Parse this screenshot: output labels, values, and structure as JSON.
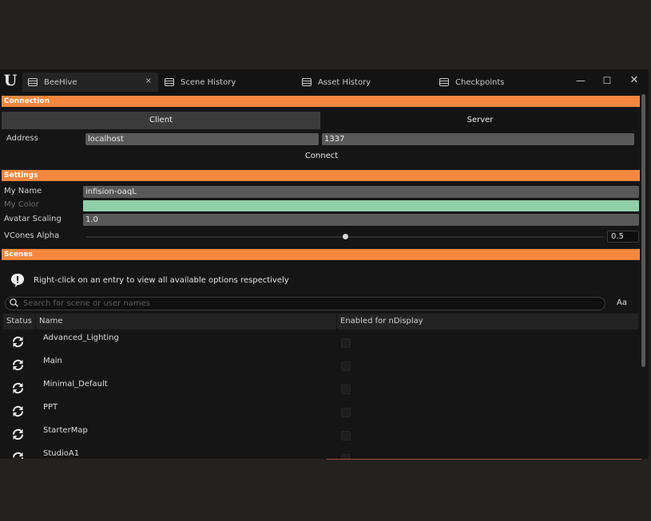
{
  "tabs": [
    {
      "label": "BeeHive",
      "icon": "window-tab-icon",
      "close": "×"
    },
    {
      "label": "Scene History",
      "icon": "window-tab-icon"
    },
    {
      "label": "Asset History",
      "icon": "window-tab-icon"
    },
    {
      "label": "Checkpoints",
      "icon": "window-tab-icon"
    }
  ],
  "window_controls": {
    "minimize": "—",
    "maximize": "☐",
    "close": "✕"
  },
  "connection": {
    "header": "Connection",
    "client_label": "Client",
    "server_label": "Server",
    "address_label": "Address",
    "address_value": "localhost",
    "port_value": "1337",
    "connect_label": "Connect"
  },
  "settings": {
    "header": "Settings",
    "my_name_label": "My Name",
    "my_name_value": "infision-oaqL",
    "my_color_label": "My Color",
    "my_color_value": "#8fd0a9",
    "avatar_scaling_label": "Avatar Scaling",
    "avatar_scaling_value": "1.0",
    "vcones_alpha_label": "VCones Alpha",
    "vcones_alpha_value": "0.5",
    "vcones_alpha_fraction": 0.5
  },
  "scenes": {
    "header": "Scenes",
    "info_text": "Right-click on an entry to view all available options respectively",
    "search_placeholder": "Search for scene or user names",
    "match_case_label": "Aa",
    "columns": {
      "status": "Status",
      "name": "Name",
      "ndisplay": "Enabled for nDisplay"
    },
    "rows": [
      {
        "name": "Advanced_Lighting",
        "ndisplay": false
      },
      {
        "name": "Main",
        "ndisplay": false
      },
      {
        "name": "Minimal_Default",
        "ndisplay": false
      },
      {
        "name": "PPT",
        "ndisplay": false
      },
      {
        "name": "StarterMap",
        "ndisplay": false
      },
      {
        "name": "StudioA1",
        "ndisplay": false
      }
    ]
  },
  "colors": {
    "accent": "#f5873f",
    "background": "#151515"
  }
}
